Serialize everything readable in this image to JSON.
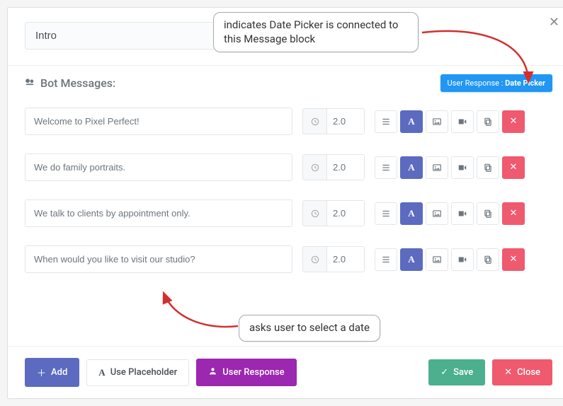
{
  "title": "Intro",
  "sectionLabel": "Bot Messages:",
  "userResponsePrefix": "User Response : ",
  "userResponseType": "Date Picker",
  "messages": [
    {
      "text": "Welcome to Pixel Perfect!",
      "delay": "2.0"
    },
    {
      "text": "We do family portraits.",
      "delay": "2.0"
    },
    {
      "text": "We talk to clients by appointment only.",
      "delay": "2.0"
    },
    {
      "text": "When would you like to visit our studio?",
      "delay": "2.0"
    }
  ],
  "footer": {
    "add": "Add",
    "placeholder": "Use Placeholder",
    "userResponse": "User Response",
    "save": "Save",
    "close": "Close"
  },
  "callouts": {
    "top": "indicates Date Picker is connected to this Message block",
    "bottom": "asks user to select a date"
  },
  "icons": {
    "chat": "chat",
    "clock": "clock",
    "list": "list",
    "text": "A",
    "image": "image",
    "video": "video",
    "copy": "copy",
    "delete": "✕",
    "plus": "＋",
    "font": "A",
    "user": "user",
    "check": "✓"
  },
  "colors": {
    "primaryBlue": "#5c6bc0",
    "brightBlue": "#2196f3",
    "purple": "#9c27b0",
    "green": "#4caf8e",
    "red": "#ef5a6f"
  }
}
